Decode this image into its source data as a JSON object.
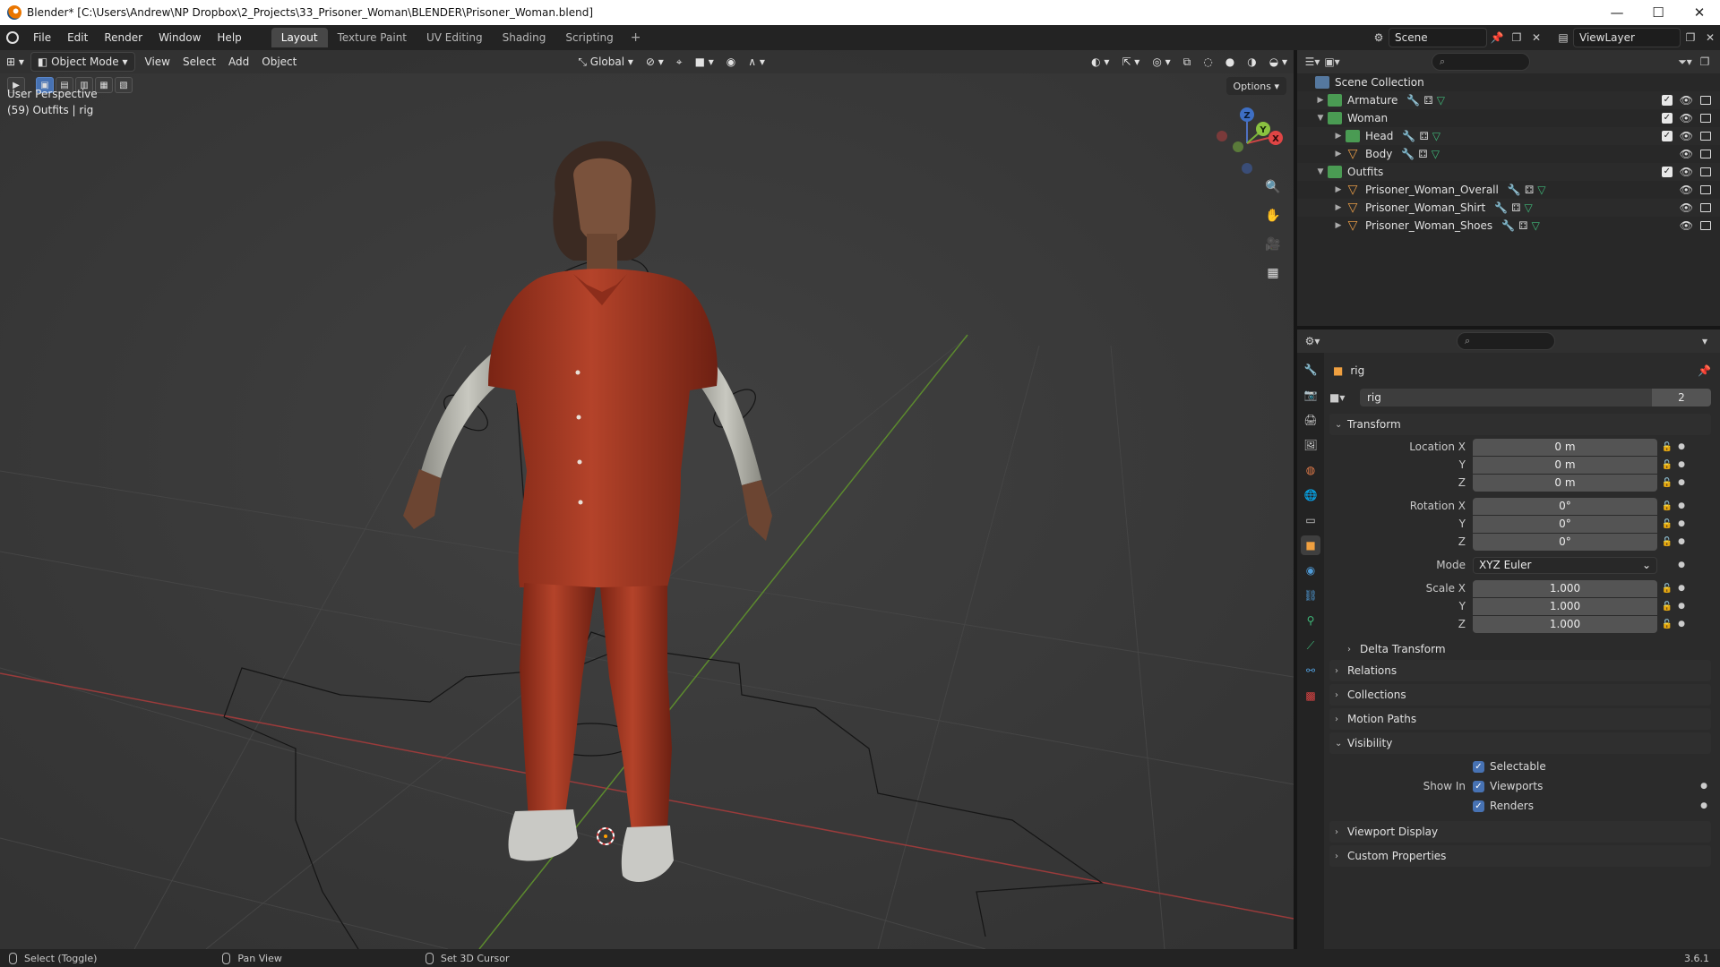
{
  "window": {
    "title": "Blender* [C:\\Users\\Andrew\\NP Dropbox\\2_Projects\\33_Prisoner_Woman\\BLENDER\\Prisoner_Woman.blend]",
    "minimize": "—",
    "maximize": "☐",
    "close": "✕"
  },
  "menu": [
    "File",
    "Edit",
    "Render",
    "Window",
    "Help"
  ],
  "workspaces": [
    "Layout",
    "Texture Paint",
    "UV Editing",
    "Shading",
    "Scripting"
  ],
  "scene": {
    "label": "Scene",
    "viewlayer": "ViewLayer"
  },
  "viewport": {
    "mode": "Object Mode",
    "menus": [
      "View",
      "Select",
      "Add",
      "Object"
    ],
    "orientation": "Global",
    "options": "Options",
    "perspective": "User Perspective",
    "context": "(59) Outfits | rig",
    "gizmo_axes": {
      "x": "X",
      "y": "Y",
      "z": "Z"
    }
  },
  "outliner": {
    "root": "Scene Collection",
    "rows": [
      {
        "label": "Armature",
        "depth": 0,
        "expanded": false,
        "kind": "collection"
      },
      {
        "label": "Woman",
        "depth": 0,
        "expanded": true,
        "kind": "collection"
      },
      {
        "label": "Head",
        "depth": 1,
        "expanded": false,
        "kind": "collection"
      },
      {
        "label": "Body",
        "depth": 1,
        "expanded": false,
        "kind": "mesh"
      },
      {
        "label": "Outfits",
        "depth": 0,
        "expanded": true,
        "kind": "collection"
      },
      {
        "label": "Prisoner_Woman_Overall",
        "depth": 1,
        "expanded": false,
        "kind": "mesh"
      },
      {
        "label": "Prisoner_Woman_Shirt",
        "depth": 1,
        "expanded": false,
        "kind": "mesh"
      },
      {
        "label": "Prisoner_Woman_Shoes",
        "depth": 1,
        "expanded": false,
        "kind": "mesh"
      }
    ]
  },
  "properties": {
    "object_name": "rig",
    "datablock": "rig",
    "users": "2",
    "transform": {
      "title": "Transform",
      "location_label": "Location X",
      "rotation_label": "Rotation X",
      "scale_label": "Scale X",
      "y": "Y",
      "z": "Z",
      "location": [
        "0 m",
        "0 m",
        "0 m"
      ],
      "rotation": [
        "0°",
        "0°",
        "0°"
      ],
      "mode_label": "Mode",
      "mode": "XYZ Euler",
      "scale": [
        "1.000",
        "1.000",
        "1.000"
      ],
      "delta": "Delta Transform"
    },
    "panels": [
      "Relations",
      "Collections",
      "Motion Paths"
    ],
    "visibility": {
      "title": "Visibility",
      "selectable": "Selectable",
      "show_in": "Show In",
      "viewports": "Viewports",
      "renders": "Renders"
    },
    "panels_after": [
      "Viewport Display",
      "Custom Properties"
    ]
  },
  "statusbar": {
    "select": "Select (Toggle)",
    "pan": "Pan View",
    "cursor": "Set 3D Cursor",
    "version": "3.6.1"
  }
}
